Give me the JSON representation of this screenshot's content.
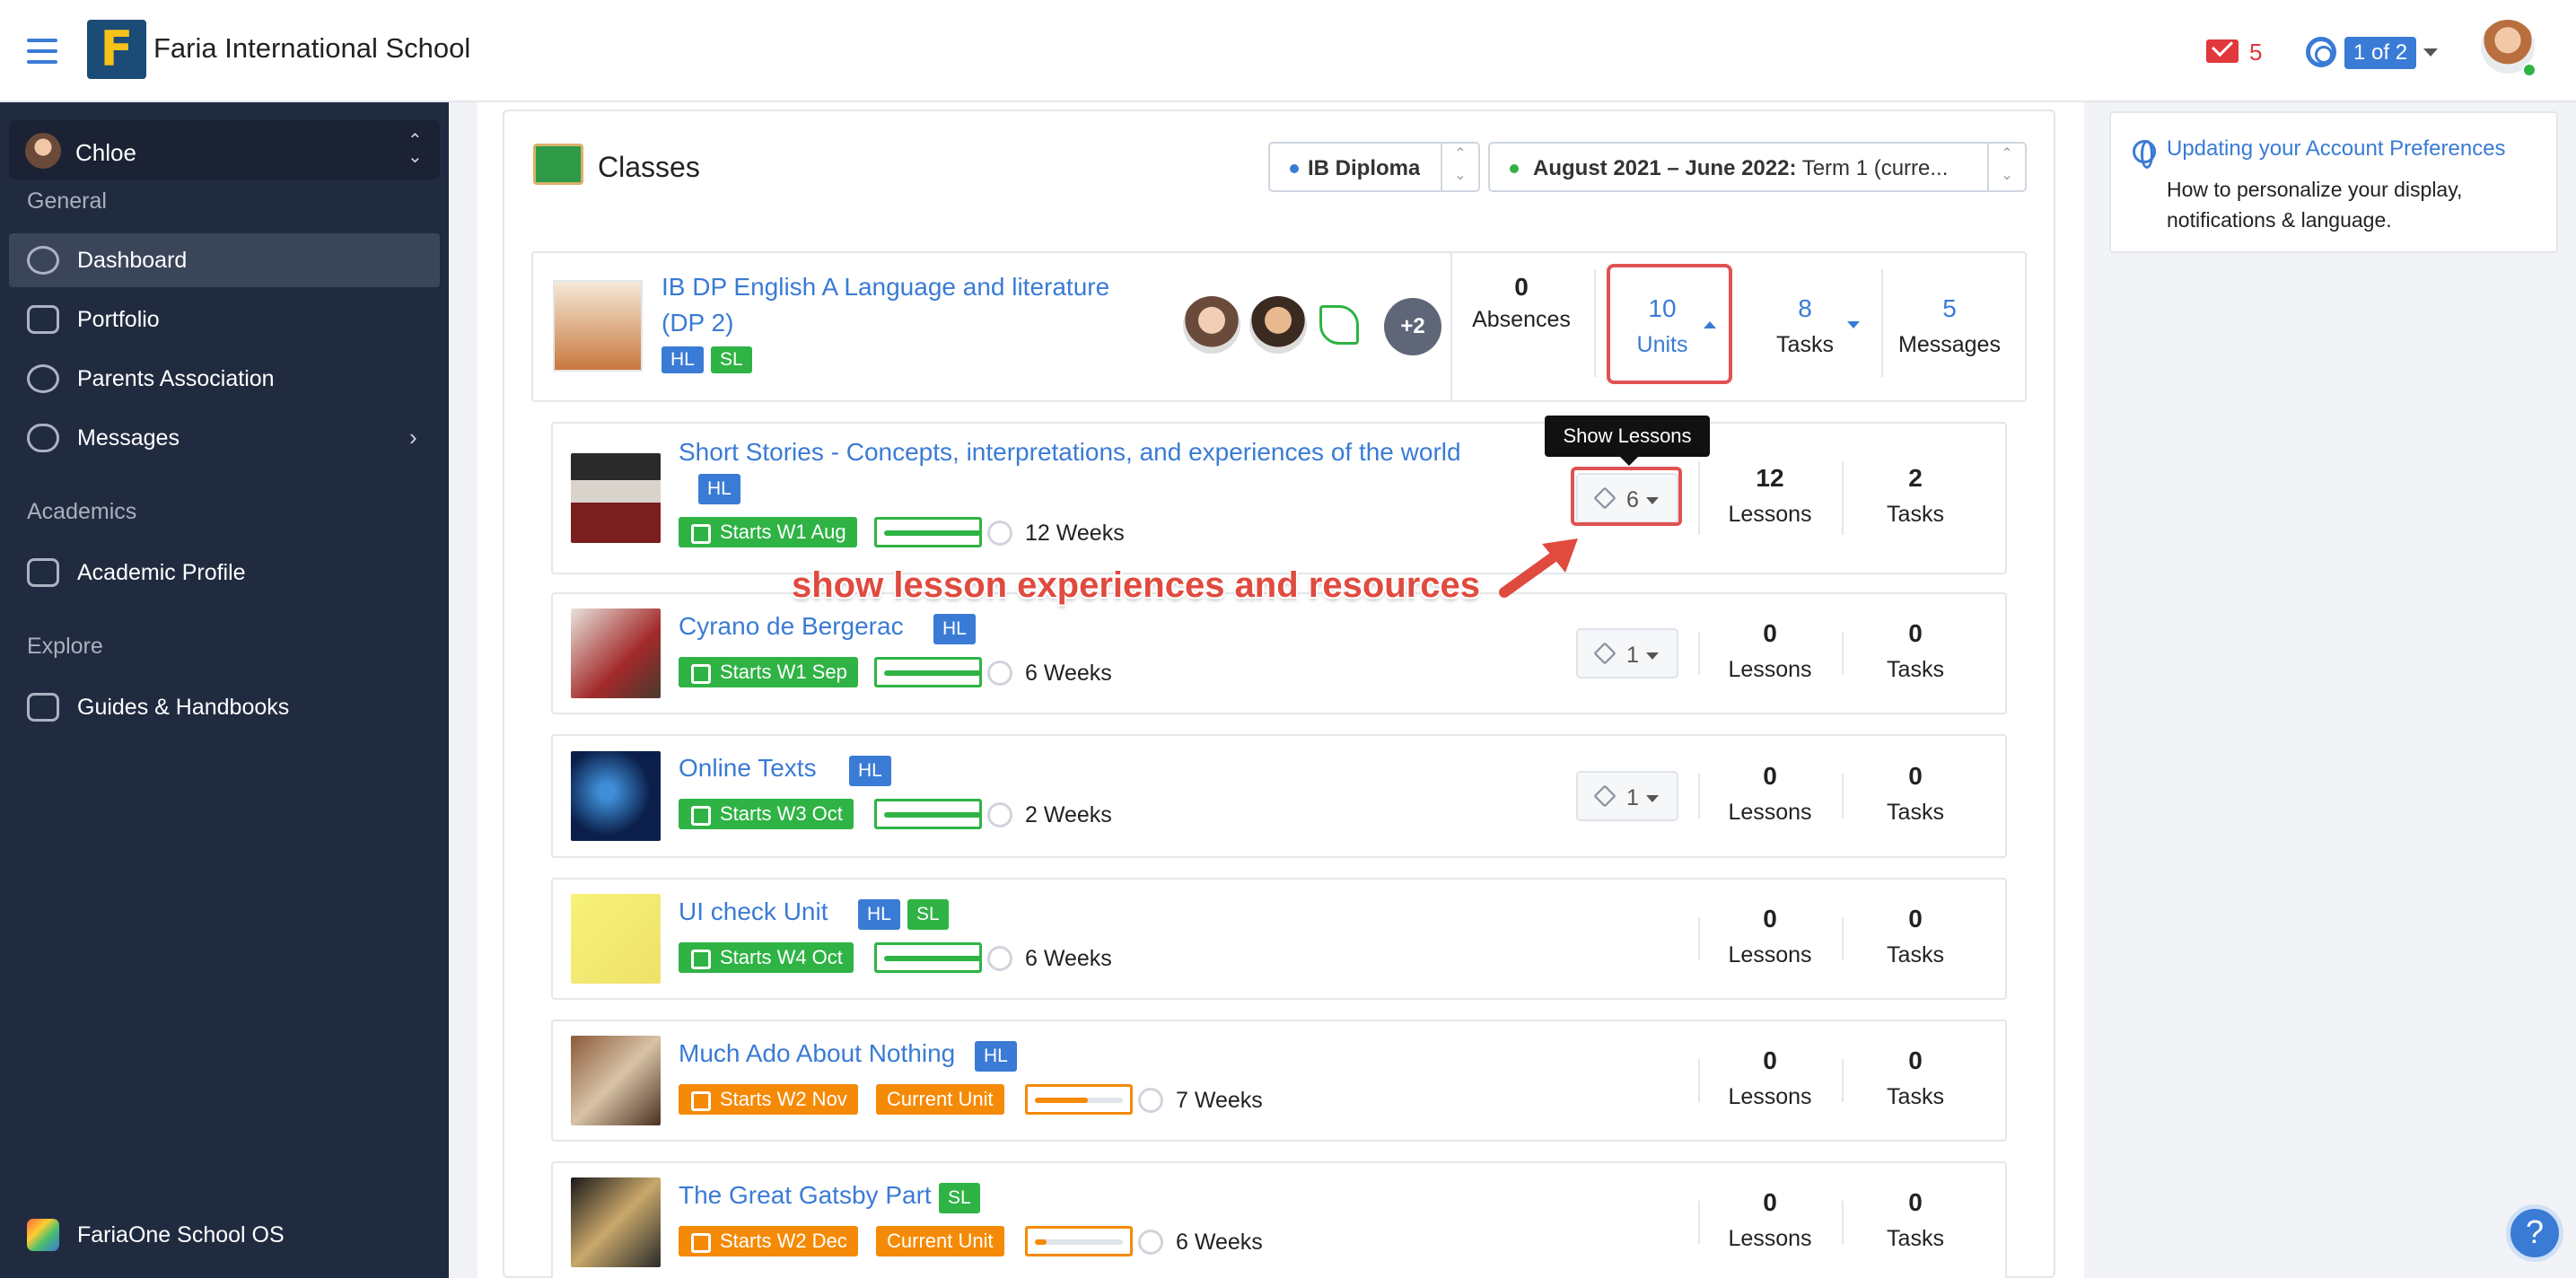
{
  "header": {
    "school_name": "Faria International School",
    "mail_count": "5",
    "pager": "1 of 2"
  },
  "sidebar": {
    "user": "Chloe",
    "sections": [
      "General",
      "Academics",
      "Explore"
    ],
    "items": [
      {
        "label": "Dashboard"
      },
      {
        "label": "Portfolio"
      },
      {
        "label": "Parents Association"
      },
      {
        "label": "Messages"
      },
      {
        "label": "Academic Profile"
      },
      {
        "label": "Guides & Handbooks"
      }
    ],
    "footer": "FariaOne School OS"
  },
  "classes": {
    "title": "Classes",
    "program": "IB Diploma",
    "term_bold": "August 2021 – June 2022:",
    "term_rest": " Term 1 (curre...",
    "class_name_line1": "IB DP English A Language and literature",
    "class_name_line2": "(DP 2)",
    "tags": [
      "HL",
      "SL"
    ],
    "more_teachers": "+2",
    "stats": [
      {
        "n": "0",
        "t": "Absences"
      },
      {
        "n": "10",
        "t": "Units"
      },
      {
        "n": "8",
        "t": "Tasks"
      },
      {
        "n": "5",
        "t": "Messages"
      }
    ]
  },
  "units": [
    {
      "title": "Short Stories - Concepts, interpretations, and experiences of the world",
      "tags": [
        "HL"
      ],
      "start": "Starts W1 Aug",
      "current": "",
      "weeks": "12 Weeks",
      "progress": 1.0,
      "lessons_btn": "6",
      "lessons": "12",
      "lessons_label": "Lessons",
      "tasks": "2",
      "tasks_label": "Tasks"
    },
    {
      "title": "Cyrano de Bergerac",
      "tags": [
        "HL"
      ],
      "start": "Starts W1 Sep",
      "current": "",
      "weeks": "6 Weeks",
      "progress": 1.0,
      "lessons_btn": "1",
      "lessons": "0",
      "lessons_label": "Lessons",
      "tasks": "0",
      "tasks_label": "Tasks"
    },
    {
      "title": "Online Texts",
      "tags": [
        "HL"
      ],
      "start": "Starts W3 Oct",
      "current": "",
      "weeks": "2 Weeks",
      "progress": 1.0,
      "lessons_btn": "1",
      "lessons": "0",
      "lessons_label": "Lessons",
      "tasks": "0",
      "tasks_label": "Tasks"
    },
    {
      "title": "UI check Unit",
      "tags": [
        "HL",
        "SL"
      ],
      "start": "Starts W4 Oct",
      "current": "",
      "weeks": "6 Weeks",
      "progress": 1.0,
      "lessons_btn": "",
      "lessons": "0",
      "lessons_label": "Lessons",
      "tasks": "0",
      "tasks_label": "Tasks"
    },
    {
      "title": "Much Ado About Nothing",
      "tags": [
        "HL"
      ],
      "start": "Starts W2 Nov",
      "current": "Current Unit",
      "weeks": "7 Weeks",
      "progress": 0.55,
      "lessons_btn": "",
      "lessons": "0",
      "lessons_label": "Lessons",
      "tasks": "0",
      "tasks_label": "Tasks"
    },
    {
      "title": "The Great Gatsby Part 1",
      "tags": [
        "SL"
      ],
      "start": "Starts W2 Dec",
      "current": "Current Unit",
      "weeks": "6 Weeks",
      "progress": 0.12,
      "lessons_btn": "",
      "lessons": "0",
      "lessons_label": "Lessons",
      "tasks": "0",
      "tasks_label": "Tasks"
    }
  ],
  "tooltip": "Show Lessons",
  "annotation": "show lesson experiences and resources",
  "help_panel": {
    "link": "Updating your Account Preferences",
    "desc": "How to personalize your display, notifications & language."
  },
  "colors": {
    "accent": "#3a7bd5",
    "green": "#2fb344",
    "orange": "#f58a07",
    "annot": "#e04a3f",
    "sidebar": "#212b40"
  }
}
